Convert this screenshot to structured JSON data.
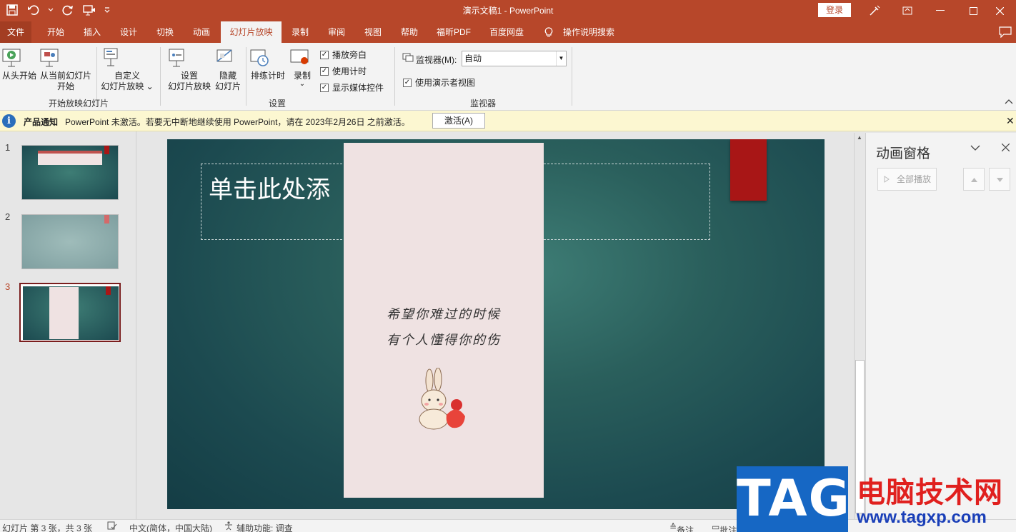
{
  "titlebar": {
    "document_title": "演示文稿1  -  PowerPoint",
    "login_label": "登录"
  },
  "tabs": [
    {
      "label": "文件"
    },
    {
      "label": "开始"
    },
    {
      "label": "插入"
    },
    {
      "label": "设计"
    },
    {
      "label": "切换"
    },
    {
      "label": "动画"
    },
    {
      "label": "幻灯片放映",
      "active": true
    },
    {
      "label": "录制"
    },
    {
      "label": "审阅"
    },
    {
      "label": "视图"
    },
    {
      "label": "帮助"
    },
    {
      "label": "福昕PDF"
    },
    {
      "label": "百度网盘"
    },
    {
      "label": "操作说明搜索"
    }
  ],
  "ribbon": {
    "start_group": {
      "from_beginning": "从头开始",
      "from_current_1": "从当前幻灯片",
      "from_current_2": "开始",
      "custom_1": "自定义",
      "custom_2": "幻灯片放映",
      "label": "开始放映幻灯片"
    },
    "setup_group": {
      "setup_1": "设置",
      "setup_2": "幻灯片放映",
      "hide_1": "隐藏",
      "hide_2": "幻灯片",
      "rehearse": "排练计时",
      "record": "录制",
      "play_narrations": "播放旁白",
      "use_timings": "使用计时",
      "show_media_controls": "显示媒体控件",
      "label": "设置"
    },
    "monitor_group": {
      "monitor_label": "监视器(M):",
      "monitor_value": "自动",
      "presenter_view": "使用演示者视图",
      "label": "监视器"
    }
  },
  "notice": {
    "title": "产品通知",
    "message": "PowerPoint 未激活。若要无中断地继续使用 PowerPoint，请在 2023年2月26日 之前激活。",
    "activate_label": "激活(A)"
  },
  "thumbnails": [
    {
      "number": "1"
    },
    {
      "number": "2"
    },
    {
      "number": "3",
      "selected": true
    }
  ],
  "slide": {
    "title_placeholder": "单击此处添",
    "poster_line_1": "希望你难过的时候",
    "poster_line_2": "有个人懂得你的伤"
  },
  "animation_pane": {
    "title": "动画窗格",
    "play_all": "全部播放"
  },
  "status": {
    "slide_info": "幻灯片 第 3 张，共 3 张",
    "language": "中文(简体，中国大陆)",
    "accessibility": "辅助功能: 调查",
    "notes": "备注",
    "comments": "批注"
  },
  "watermark": {
    "tag": "TAG",
    "site_name": "电脑技术网",
    "url": "www.tagxp.com"
  },
  "colors": {
    "brand": "#b7472a",
    "slide_bg": "#2a5f5c",
    "accent_red": "#a81616"
  }
}
